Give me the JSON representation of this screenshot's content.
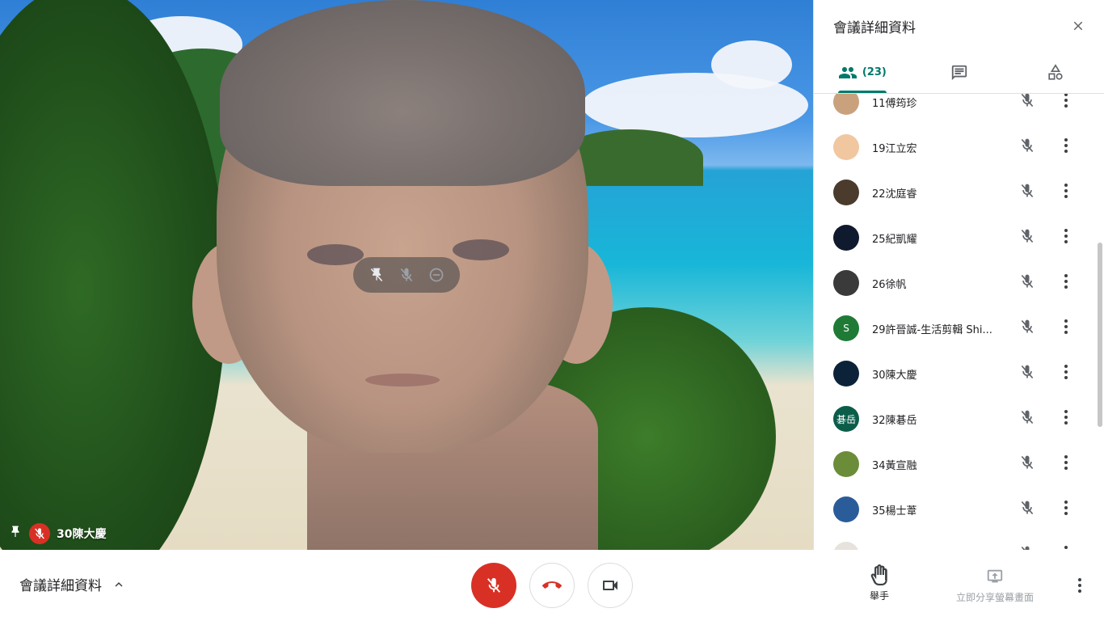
{
  "stage": {
    "speaker_name": "30陳大慶",
    "tile_controls": [
      "pin-off-icon",
      "mic-off-icon",
      "remove-icon"
    ]
  },
  "panel": {
    "title": "會議詳細資料",
    "tabs": [
      {
        "icon": "people-icon",
        "count": "(23)",
        "active": true
      },
      {
        "icon": "chat-icon",
        "active": false
      },
      {
        "icon": "activities-icon",
        "active": false
      }
    ],
    "participants": [
      {
        "name": "11傅筠珍",
        "avatar_color": "#c9a27d",
        "avatar_text": ""
      },
      {
        "name": "19江立宏",
        "avatar_color": "#f1c7a0",
        "avatar_text": ""
      },
      {
        "name": "22沈庭睿",
        "avatar_color": "#4a3b2c",
        "avatar_text": ""
      },
      {
        "name": "25紀凱耀",
        "avatar_color": "#101a2e",
        "avatar_text": ""
      },
      {
        "name": "26徐帆",
        "avatar_color": "#3a3a3a",
        "avatar_text": ""
      },
      {
        "name": "29許晉誠-生活剪輯 Shi...",
        "avatar_color": "#1f7a36",
        "avatar_text": "S"
      },
      {
        "name": "30陳大慶",
        "avatar_color": "#0c2238",
        "avatar_text": ""
      },
      {
        "name": "32陳碁岳",
        "avatar_color": "#0b5d4a",
        "avatar_text": "碁岳"
      },
      {
        "name": "34黃宣融",
        "avatar_color": "#6b8d3a",
        "avatar_text": ""
      },
      {
        "name": "35楊士葦",
        "avatar_color": "#2b5c9a",
        "avatar_text": ""
      },
      {
        "name": "",
        "avatar_color": "#e8e2dc",
        "avatar_text": ""
      }
    ]
  },
  "bottom": {
    "details_label": "會議詳細資料",
    "raise_hand_label": "舉手",
    "present_label": "立即分享螢幕畫面"
  },
  "colors": {
    "accent": "#00796b",
    "danger": "#d93025"
  }
}
